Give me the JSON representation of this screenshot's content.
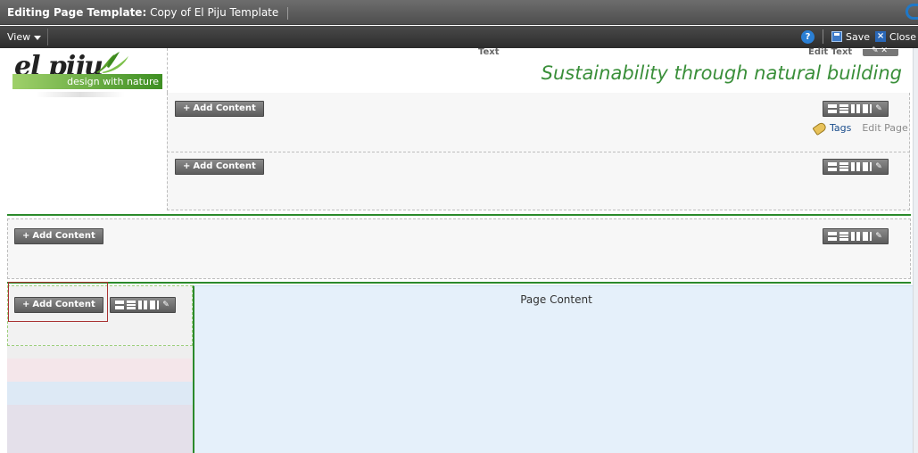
{
  "titlebar": {
    "prefix": "Editing Page Template:",
    "name": "Copy of El Piju Template"
  },
  "toolbar": {
    "view_label": "View",
    "save_label": "Save",
    "close_label": "Close",
    "help_icon": "help-icon"
  },
  "header": {
    "logo_text": "el piju",
    "logo_tagline": "design with nature",
    "text_label": "Text",
    "edit_text_label": "Edit Text",
    "tagline": "Sustainability through natural building"
  },
  "regions": {
    "add_content_label": "Add Content",
    "tags_label": "Tags",
    "edit_page_label": "Edit Page",
    "page_content_label": "Page Content"
  },
  "colors": {
    "accent_green": "#2b8a2b",
    "content_bg": "#e5f0fa",
    "highlight": "#a33333"
  }
}
